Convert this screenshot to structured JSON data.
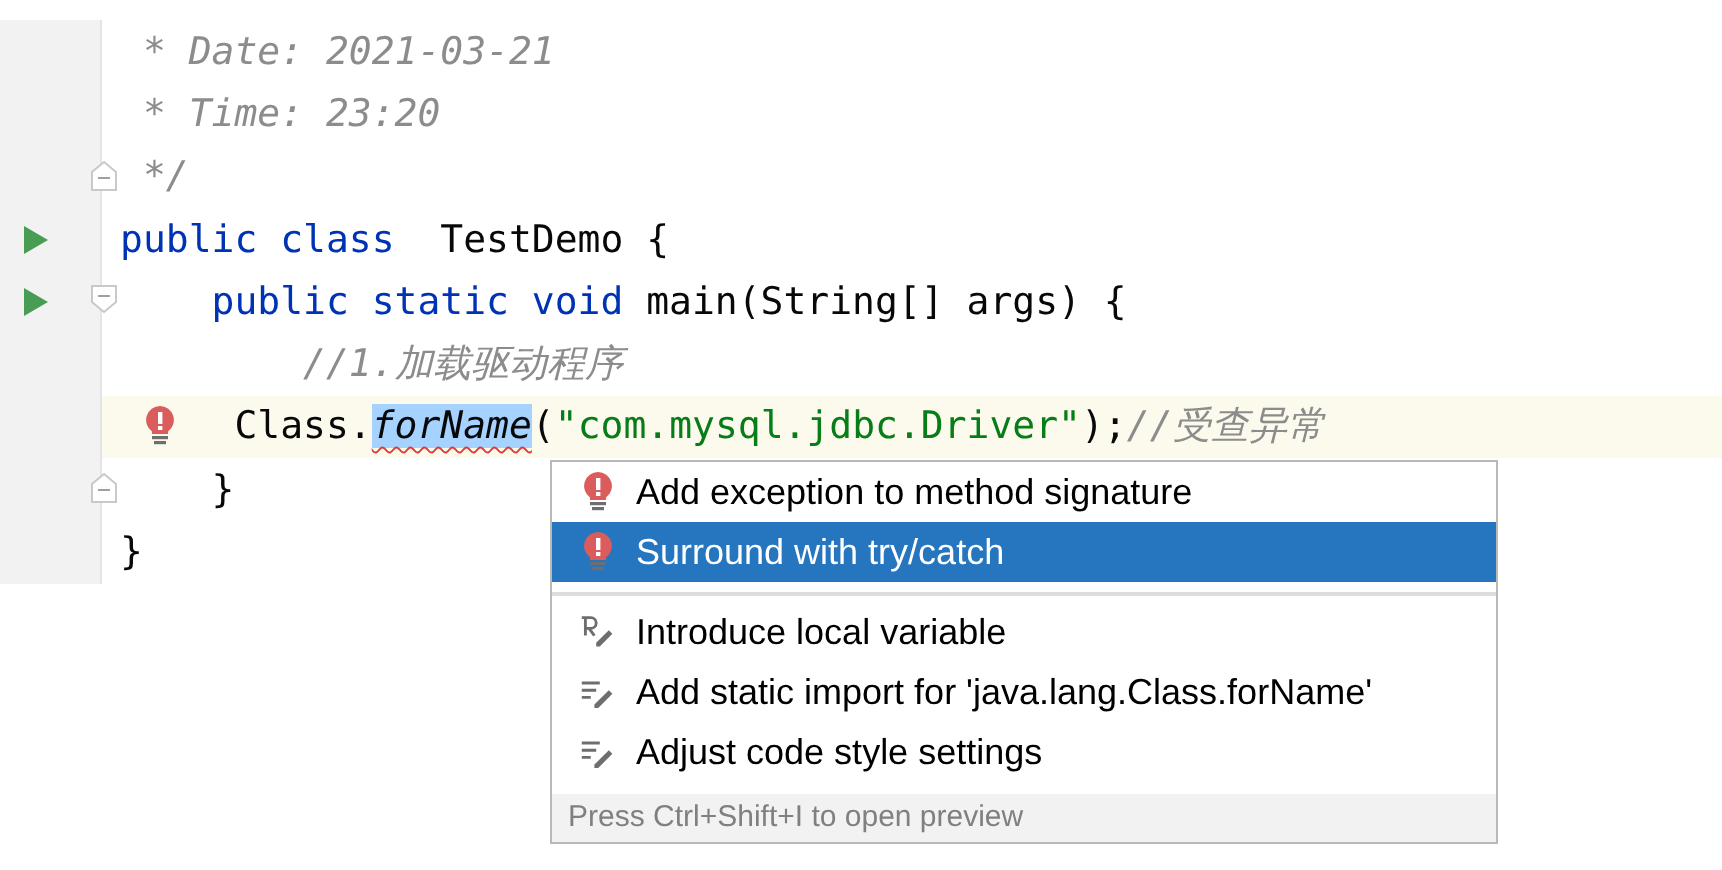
{
  "editor": {
    "lines": [
      {
        "run": false,
        "fold_start": false,
        "fold_end": false,
        "highlighted": false,
        "bulb": false,
        "tokens": [
          {
            "kind": "comment",
            "text": " * Date: 2021-03-21"
          }
        ]
      },
      {
        "run": false,
        "fold_start": false,
        "fold_end": false,
        "highlighted": false,
        "bulb": false,
        "tokens": [
          {
            "kind": "comment",
            "text": " * Time: 23:20"
          }
        ]
      },
      {
        "run": false,
        "fold_start": false,
        "fold_end": true,
        "highlighted": false,
        "bulb": false,
        "tokens": [
          {
            "kind": "comment",
            "text": " */"
          }
        ]
      },
      {
        "run": true,
        "fold_start": false,
        "fold_end": false,
        "highlighted": false,
        "bulb": false,
        "tokens": [
          {
            "kind": "keyword",
            "text": "public class "
          },
          {
            "kind": "plain",
            "text": " TestDemo {"
          }
        ]
      },
      {
        "run": true,
        "fold_start": true,
        "fold_end": false,
        "highlighted": false,
        "bulb": false,
        "tokens": [
          {
            "kind": "keyword",
            "text": "    public static void "
          },
          {
            "kind": "plain",
            "text": "main(String[] args) {"
          }
        ]
      },
      {
        "run": false,
        "fold_start": false,
        "fold_end": false,
        "highlighted": false,
        "bulb": false,
        "tokens": [
          {
            "kind": "line-comment",
            "text": "        //1.加载驱动程序"
          }
        ]
      },
      {
        "run": false,
        "fold_start": false,
        "fold_end": false,
        "highlighted": true,
        "bulb": true,
        "tokens": [
          {
            "kind": "plain",
            "text": "     Class."
          },
          {
            "kind": "error-selected",
            "text": "forName"
          },
          {
            "kind": "plain",
            "text": "("
          },
          {
            "kind": "string",
            "text": "\"com.mysql.jdbc.Driver\""
          },
          {
            "kind": "plain",
            "text": ");"
          },
          {
            "kind": "line-comment",
            "text": "//受查异常"
          }
        ]
      },
      {
        "run": false,
        "fold_start": false,
        "fold_end": true,
        "highlighted": false,
        "bulb": false,
        "tokens": [
          {
            "kind": "plain",
            "text": "    }"
          }
        ]
      },
      {
        "run": false,
        "fold_start": false,
        "fold_end": false,
        "highlighted": false,
        "bulb": false,
        "tokens": [
          {
            "kind": "plain",
            "text": "}"
          }
        ]
      }
    ]
  },
  "popup": {
    "items": [
      {
        "kind": "error",
        "label": "Add exception to method signature",
        "selected": false
      },
      {
        "kind": "error",
        "label": "Surround with try/catch",
        "selected": true
      },
      {
        "kind": "separator"
      },
      {
        "kind": "refactor",
        "label": "Introduce local variable",
        "selected": false
      },
      {
        "kind": "edit",
        "label": "Add static import for 'java.lang.Class.forName'",
        "selected": false
      },
      {
        "kind": "edit",
        "label": "Adjust code style settings",
        "selected": false
      }
    ],
    "footer": "Press Ctrl+Shift+I to open preview"
  }
}
